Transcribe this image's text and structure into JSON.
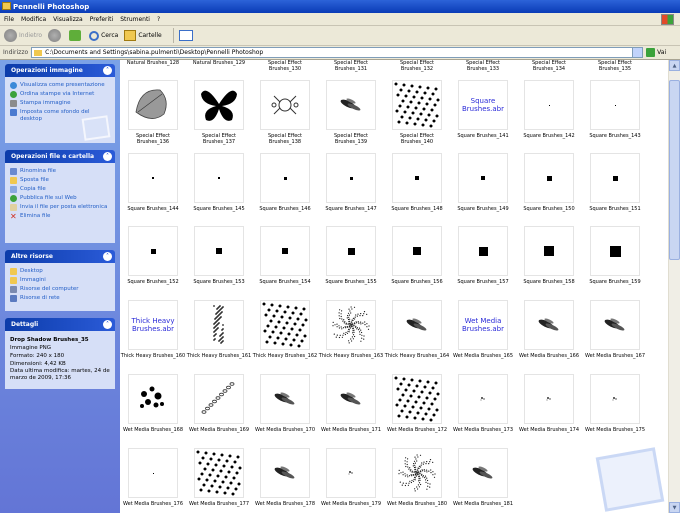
{
  "window": {
    "title": "Pennelli Photoshop"
  },
  "menu": [
    "File",
    "Modifica",
    "Visualizza",
    "Preferiti",
    "Strumenti",
    "?"
  ],
  "toolbar": {
    "back": "Indietro",
    "search": "Cerca",
    "folders": "Cartelle"
  },
  "address": {
    "label": "Indirizzo",
    "path": "C:\\Documents and Settings\\sabina.pulmenti\\Desktop\\Pennelli Photoshop",
    "go": "Vai"
  },
  "sidebar": {
    "image_tasks": {
      "title": "Operazioni immagine",
      "items": [
        "Visualizza come presentazione",
        "Ordina stampe via Internet",
        "Stampa immagine",
        "Imposta come sfondo del desktop"
      ]
    },
    "file_tasks": {
      "title": "Operazioni file e cartella",
      "items": [
        "Rinomina file",
        "Sposta file",
        "Copia file",
        "Pubblica file sul Web",
        "Invia il file per posta elettronica",
        "Elimina file"
      ]
    },
    "other_places": {
      "title": "Altre risorse",
      "items": [
        "Desktop",
        "Immagini",
        "Risorse del computer",
        "Risorse di rete"
      ]
    },
    "details": {
      "title": "Dettagli",
      "name": "Drop Shadow Brushes_35",
      "type": "Immagine PNG",
      "format": "Formato: 240 x 180",
      "size": "Dimensioni: 4,42 KB",
      "modified": "Data ultima modifica: martes, 24 de marzo de 2009, 17:36"
    }
  },
  "files": [
    {
      "label": "Natural Brushes_128"
    },
    {
      "label": "Natural Brushes_129"
    },
    {
      "label": "Special Effect Brushes_130"
    },
    {
      "label": "Special Effect Brushes_131"
    },
    {
      "label": "Special Effect Brushes_132"
    },
    {
      "label": "Special Effect Brushes_133"
    },
    {
      "label": "Special Effect Brushes_134"
    },
    {
      "label": "Special Effect Brushes_135"
    },
    {
      "label": "Special Effect Brushes_136",
      "kind": "leaf"
    },
    {
      "label": "Special Effect Brushes_137",
      "kind": "butterfly"
    },
    {
      "label": "Special Effect Brushes_138",
      "kind": "pattern"
    },
    {
      "label": "Special Effect Brushes_139",
      "kind": "smudge"
    },
    {
      "label": "Special Effect Brushes_140",
      "kind": "noise"
    },
    {
      "label": "Square Brushes_141",
      "kind": "text",
      "text": "Square Brushes.abr"
    },
    {
      "label": "Square Brushes_142",
      "kind": "dot",
      "size": 1
    },
    {
      "label": "Square Brushes_143",
      "kind": "dot",
      "size": 1
    },
    {
      "label": "Square Brushes_144",
      "kind": "dot",
      "size": 2
    },
    {
      "label": "Square Brushes_145",
      "kind": "dot",
      "size": 2
    },
    {
      "label": "Square Brushes_146",
      "kind": "dot",
      "size": 3
    },
    {
      "label": "Square Brushes_147",
      "kind": "dot",
      "size": 3
    },
    {
      "label": "Square Brushes_148",
      "kind": "dot",
      "size": 4
    },
    {
      "label": "Square Brushes_149",
      "kind": "dot",
      "size": 4
    },
    {
      "label": "Square Brushes_150",
      "kind": "dot",
      "size": 5
    },
    {
      "label": "Square Brushes_151",
      "kind": "dot",
      "size": 5
    },
    {
      "label": "Square Brushes_152",
      "kind": "dot",
      "size": 5
    },
    {
      "label": "Square Brushes_153",
      "kind": "dot",
      "size": 6
    },
    {
      "label": "Square Brushes_154",
      "kind": "dot",
      "size": 6
    },
    {
      "label": "Square Brushes_155",
      "kind": "dot",
      "size": 7
    },
    {
      "label": "Square Brushes_156",
      "kind": "dot",
      "size": 8
    },
    {
      "label": "Square Brushes_157",
      "kind": "dot",
      "size": 9
    },
    {
      "label": "Square Brushes_158",
      "kind": "dot",
      "size": 10
    },
    {
      "label": "Square Brushes_159",
      "kind": "dot",
      "size": 11
    },
    {
      "label": "Thick Heavy Brushes_160",
      "kind": "text",
      "text": "Thick Heavy Brushes.abr"
    },
    {
      "label": "Thick Heavy Brushes_161",
      "kind": "streak"
    },
    {
      "label": "Thick Heavy Brushes_162",
      "kind": "noise"
    },
    {
      "label": "Thick Heavy Brushes_163",
      "kind": "speckle"
    },
    {
      "label": "Thick Heavy Brushes_164",
      "kind": "smudge"
    },
    {
      "label": "Wet Media Brushes_165",
      "kind": "text",
      "text": "Wet Media Brushes.abr"
    },
    {
      "label": "Wet Media Brushes_166",
      "kind": "smudge"
    },
    {
      "label": "Wet Media Brushes_167",
      "kind": "smudge"
    },
    {
      "label": "Wet Media Brushes_168",
      "kind": "spots"
    },
    {
      "label": "Wet Media Brushes_169",
      "kind": "chain"
    },
    {
      "label": "Wet Media Brushes_170",
      "kind": "smudge"
    },
    {
      "label": "Wet Media Brushes_171",
      "kind": "smudge"
    },
    {
      "label": "Wet Media Brushes_172",
      "kind": "noise"
    },
    {
      "label": "Wet Media Brushes_173",
      "kind": "tiny"
    },
    {
      "label": "Wet Media Brushes_174",
      "kind": "tiny"
    },
    {
      "label": "Wet Media Brushes_175",
      "kind": "tiny"
    },
    {
      "label": "Wet Media Brushes_176",
      "kind": "dot",
      "size": 1
    },
    {
      "label": "Wet Media Brushes_177",
      "kind": "noise"
    },
    {
      "label": "Wet Media Brushes_178",
      "kind": "smudge"
    },
    {
      "label": "Wet Media Brushes_179",
      "kind": "tiny"
    },
    {
      "label": "Wet Media Brushes_180",
      "kind": "speckle"
    },
    {
      "label": "Wet Media Brushes_181",
      "kind": "smudge"
    }
  ]
}
